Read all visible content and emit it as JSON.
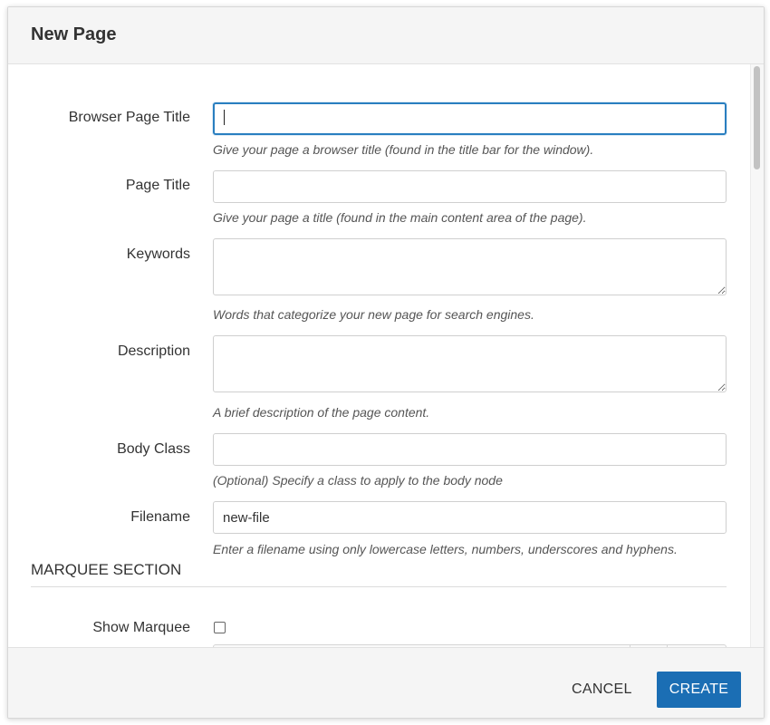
{
  "dialog": {
    "title": "New Page"
  },
  "fields": {
    "browser_page_title": {
      "label": "Browser Page Title",
      "value": "",
      "help": "Give your page a browser title (found in the title bar for the window)."
    },
    "page_title": {
      "label": "Page Title",
      "value": "",
      "help": "Give your page a title (found in the main content area of the page)."
    },
    "keywords": {
      "label": "Keywords",
      "value": "",
      "help": "Words that categorize your new page for search engines."
    },
    "description": {
      "label": "Description",
      "value": "",
      "help": "A brief description of the page content."
    },
    "body_class": {
      "label": "Body Class",
      "value": "",
      "help": "(Optional) Specify a class to apply to the body node"
    },
    "filename": {
      "label": "Filename",
      "value": "new-file",
      "help": "Enter a filename using only lowercase letters, numbers, underscores and hyphens."
    }
  },
  "marquee_section": {
    "title": "MARQUEE SECTION",
    "show_marquee": {
      "label": "Show Marquee",
      "checked": false
    }
  },
  "footer": {
    "cancel_label": "CANCEL",
    "create_label": "CREATE"
  },
  "colors": {
    "primary": "#1b6eb4",
    "focus_border": "#2a7fc0",
    "header_bg": "#f5f5f5"
  }
}
